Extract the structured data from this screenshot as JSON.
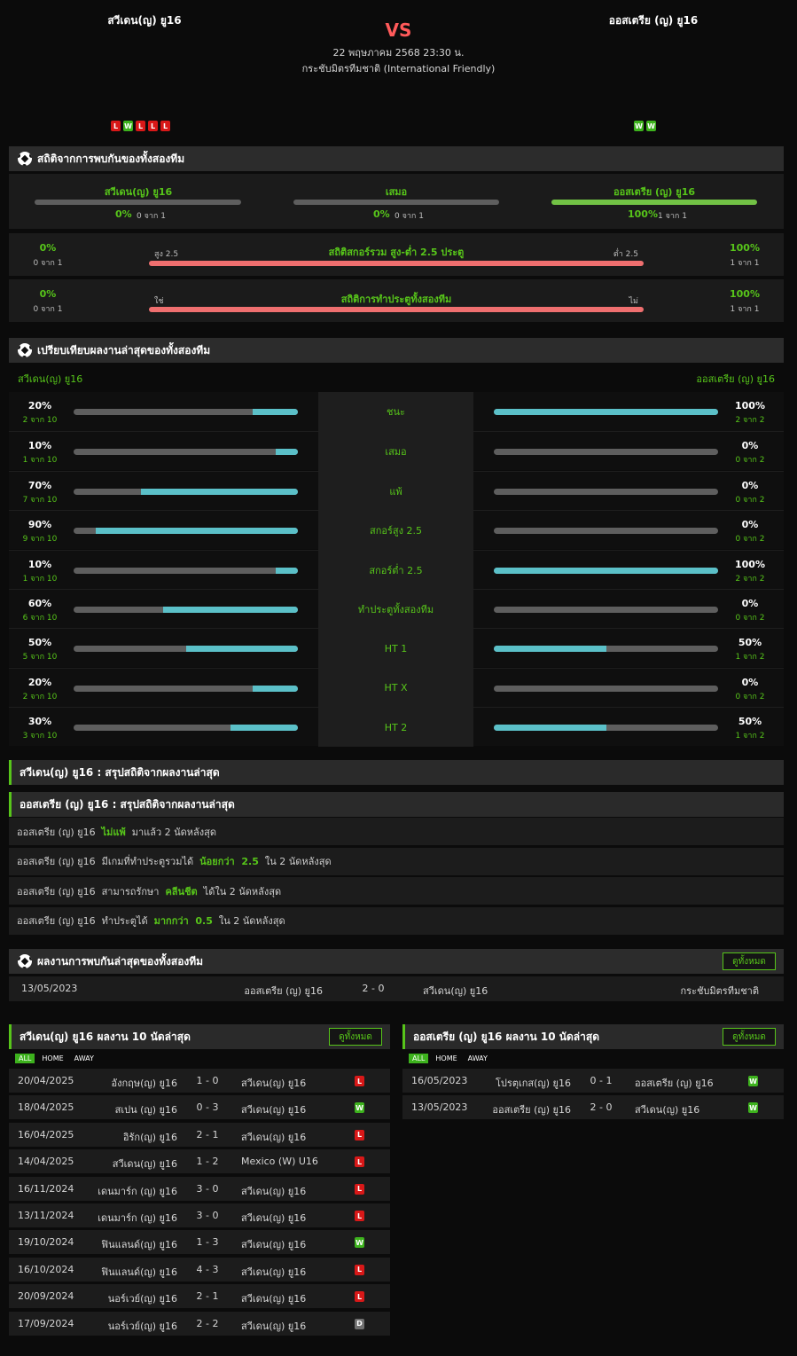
{
  "header": {
    "home": "สวีเดน(ญ) ยู16",
    "away": "ออสเตรีย (ญ) ยู16",
    "vs": "VS",
    "datetime": "22 พฤษภาคม 2568 23:30 น.",
    "competition": "กระชับมิตรทีมชาติ (International Friendly)",
    "home_form": [
      "L",
      "W",
      "L",
      "L",
      "L"
    ],
    "away_form": [
      "W",
      "W"
    ]
  },
  "h2h": {
    "title": "สถิติจากการพบกันของทั้งสองทีม",
    "home_label": "สวีเดน(ญ) ยู16",
    "draw_label": "เสมอ",
    "away_label": "ออสเตรีย (ญ) ยู16",
    "home_pct": "0%",
    "home_count": "0 จาก 1",
    "draw_pct": "0%",
    "draw_count": "0 จาก 1",
    "away_pct": "100%",
    "away_count": "1 จาก 1",
    "home_value": 0,
    "draw_value": 0,
    "away_value": 100,
    "ou": {
      "title": "สถิติสกอร์รวม สูง-ต่ำ 2.5 ประตู",
      "left_label": "สูง 2.5",
      "right_label": "ต่ำ 2.5",
      "left_pct": "0%",
      "left_count": "0 จาก 1",
      "right_pct": "100%",
      "right_count": "1 จาก 1"
    },
    "btts": {
      "title": "สถิติการทำประตูทั้งสองทีม",
      "left_label": "ใช่",
      "right_label": "ไม่",
      "left_pct": "0%",
      "left_count": "0 จาก 1",
      "right_pct": "100%",
      "right_count": "1 จาก 1"
    }
  },
  "compare": {
    "title": "เปรียบเทียบผลงานล่าสุดของทั้งสองทีม",
    "home": "สวีเดน(ญ) ยู16",
    "away": "ออสเตรีย (ญ) ยู16",
    "rows": [
      {
        "label": "ชนะ",
        "lp": "20%",
        "lc": "2 จาก 10",
        "lv": 20,
        "rp": "100%",
        "rc": "2 จาก 2",
        "rv": 100
      },
      {
        "label": "เสมอ",
        "lp": "10%",
        "lc": "1 จาก 10",
        "lv": 10,
        "rp": "0%",
        "rc": "0 จาก 2",
        "rv": 0
      },
      {
        "label": "แพ้",
        "lp": "70%",
        "lc": "7 จาก 10",
        "lv": 70,
        "rp": "0%",
        "rc": "0 จาก 2",
        "rv": 0
      },
      {
        "label": "สกอร์สูง 2.5",
        "lp": "90%",
        "lc": "9 จาก 10",
        "lv": 90,
        "rp": "0%",
        "rc": "0 จาก 2",
        "rv": 0
      },
      {
        "label": "สกอร์ต่ำ 2.5",
        "lp": "10%",
        "lc": "1 จาก 10",
        "lv": 10,
        "rp": "100%",
        "rc": "2 จาก 2",
        "rv": 100
      },
      {
        "label": "ทำประตูทั้งสองทีม",
        "lp": "60%",
        "lc": "6 จาก 10",
        "lv": 60,
        "rp": "0%",
        "rc": "0 จาก 2",
        "rv": 0
      },
      {
        "label": "HT 1",
        "lp": "50%",
        "lc": "5 จาก 10",
        "lv": 50,
        "rp": "50%",
        "rc": "1 จาก 2",
        "rv": 50
      },
      {
        "label": "HT X",
        "lp": "20%",
        "lc": "2 จาก 10",
        "lv": 20,
        "rp": "0%",
        "rc": "0 จาก 2",
        "rv": 0
      },
      {
        "label": "HT 2",
        "lp": "30%",
        "lc": "3 จาก 10",
        "lv": 30,
        "rp": "50%",
        "rc": "1 จาก 2",
        "rv": 50
      }
    ]
  },
  "summary": {
    "home_title": "สวีเดน(ญ) ยู16 : สรุปสถิติจากผลงานล่าสุด",
    "away_title": "ออสเตรีย (ญ) ยู16 : สรุปสถิติจากผลงานล่าสุด",
    "rows": [
      {
        "a": "ออสเตรีย (ญ) ยู16  ",
        "hl": "ไม่แพ้",
        "b": "  มาแล้ว 2 นัดหลังสุด"
      },
      {
        "a": "ออสเตรีย (ญ) ยู16  มีเกมที่ทำประตูรวมได้  ",
        "hl": "น้อยกว่า  2.5",
        "b": "  ใน 2 นัดหลังสุด"
      },
      {
        "a": "ออสเตรีย (ญ) ยู16  สามารถรักษา  ",
        "hl": "คลีนชีต",
        "b": "  ได้ใน 2 นัดหลังสุด"
      },
      {
        "a": "ออสเตรีย (ญ) ยู16  ทำประตูได้  ",
        "hl": "มากกว่า  0.5",
        "b": "  ใน 2 นัดหลังสุด"
      }
    ]
  },
  "last_h2h": {
    "title": "ผลงานการพบกันล่าสุดของทั้งสองทีม",
    "view_all": "ดูทั้งหมด",
    "date": "13/05/2023",
    "home": "ออสเตรีย (ญ) ยู16",
    "score": "2 - 0",
    "away": "สวีเดน(ญ) ยู16",
    "competition": "กระชับมิตรทีมชาติ"
  },
  "home_recent": {
    "title": "สวีเดน(ญ) ยู16 ผลงาน 10 นัดล่าสุด",
    "view_all": "ดูทั้งหมด",
    "filters": [
      "ALL",
      "HOME",
      "AWAY"
    ],
    "matches": [
      {
        "date": "20/04/2025",
        "home": "อังกฤษ(ญ) ยู16",
        "score": "1 - 0",
        "away": "สวีเดน(ญ) ยู16",
        "res": "L"
      },
      {
        "date": "18/04/2025",
        "home": "สเปน (ญ) ยู16",
        "score": "0 - 3",
        "away": "สวีเดน(ญ) ยู16",
        "res": "W"
      },
      {
        "date": "16/04/2025",
        "home": "อิรัก(ญ) ยู16",
        "score": "2 - 1",
        "away": "สวีเดน(ญ) ยู16",
        "res": "L"
      },
      {
        "date": "14/04/2025",
        "home": "สวีเดน(ญ) ยู16",
        "score": "1 - 2",
        "away": "Mexico (W) U16",
        "res": "L"
      },
      {
        "date": "16/11/2024",
        "home": "เดนมาร์ก (ญ) ยู16",
        "score": "3 - 0",
        "away": "สวีเดน(ญ) ยู16",
        "res": "L"
      },
      {
        "date": "13/11/2024",
        "home": "เดนมาร์ก (ญ) ยู16",
        "score": "3 - 0",
        "away": "สวีเดน(ญ) ยู16",
        "res": "L"
      },
      {
        "date": "19/10/2024",
        "home": "ฟินแลนด์(ญ) ยู16",
        "score": "1 - 3",
        "away": "สวีเดน(ญ) ยู16",
        "res": "W"
      },
      {
        "date": "16/10/2024",
        "home": "ฟินแลนด์(ญ) ยู16",
        "score": "4 - 3",
        "away": "สวีเดน(ญ) ยู16",
        "res": "L"
      },
      {
        "date": "20/09/2024",
        "home": "นอร์เวย์(ญ) ยู16",
        "score": "2 - 1",
        "away": "สวีเดน(ญ) ยู16",
        "res": "L"
      },
      {
        "date": "17/09/2024",
        "home": "นอร์เวย์(ญ) ยู16",
        "score": "2 - 2",
        "away": "สวีเดน(ญ) ยู16",
        "res": "D"
      }
    ]
  },
  "away_recent": {
    "title": "ออสเตรีย (ญ) ยู16 ผลงาน 10 นัดล่าสุด",
    "view_all": "ดูทั้งหมด",
    "filters": [
      "ALL",
      "HOME",
      "AWAY"
    ],
    "matches": [
      {
        "date": "16/05/2023",
        "home": "โปรตุเกส(ญ) ยู16",
        "score": "0 - 1",
        "away": "ออสเตรีย (ญ) ยู16",
        "res": "W"
      },
      {
        "date": "13/05/2023",
        "home": "ออสเตรีย (ญ) ยู16",
        "score": "2 - 0",
        "away": "สวีเดน(ญ) ยู16",
        "res": "W"
      }
    ]
  },
  "colors": {
    "accent": "#57c51a",
    "bar_fill": "#5bc0c8",
    "loss": "#d81818",
    "win": "#3db21d",
    "vs": "#ff5a5a"
  }
}
